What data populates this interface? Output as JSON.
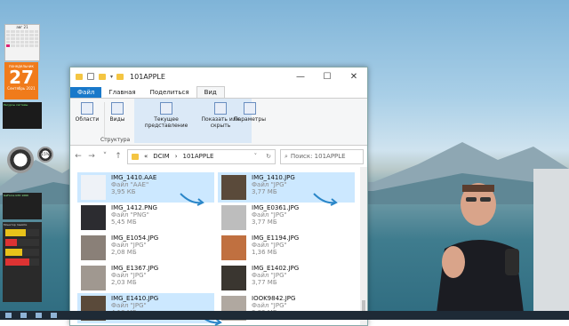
{
  "window": {
    "title": "101APPLE",
    "controls": {
      "minimize": "—",
      "maximize": "☐",
      "close": "✕"
    }
  },
  "ribbon_tabs": [
    "Файл",
    "Главная",
    "Поделиться",
    "Вид"
  ],
  "ribbon": {
    "panels": "Области",
    "views": "Виды",
    "current_view": "Текущее представление",
    "show_hide": "Показать или скрыть",
    "options": "Параметры",
    "group_structure": "Структура"
  },
  "address": {
    "prefix": "«",
    "crumbs": [
      "DCIM",
      "101APPLE"
    ],
    "search_placeholder": "Поиск: 101APPLE"
  },
  "files": [
    {
      "name": "IMG_1410.AAE",
      "type": "Файл \"AAE\"",
      "size": "3,95 КБ",
      "selected": true,
      "thumb": "#eef2f7"
    },
    {
      "name": "IMG_1410.JPG",
      "type": "Файл \"JPG\"",
      "size": "3,77 МБ",
      "selected": true,
      "thumb": "#5a4a3a"
    },
    {
      "name": "IMG_1412.PNG",
      "type": "Файл \"PNG\"",
      "size": "5,45 МБ",
      "selected": false,
      "thumb": "#2c2c30"
    },
    {
      "name": "IMG_E0361.JPG",
      "type": "Файл \"JPG\"",
      "size": "3,77 МБ",
      "selected": false,
      "thumb": "#bdbdbd"
    },
    {
      "name": "IMG_E1054.JPG",
      "type": "Файл \"JPG\"",
      "size": "2,08 МБ",
      "selected": false,
      "thumb": "#8a8078"
    },
    {
      "name": "IMG_E1194.JPG",
      "type": "Файл \"JPG\"",
      "size": "1,36 МБ",
      "selected": false,
      "thumb": "#c07040"
    },
    {
      "name": "IMG_E1367.JPG",
      "type": "Файл \"JPG\"",
      "size": "2,03 МБ",
      "selected": false,
      "thumb": "#a09890"
    },
    {
      "name": "IMG_E1402.JPG",
      "type": "Файл \"JPG\"",
      "size": "3,77 МБ",
      "selected": false,
      "thumb": "#3a3630"
    },
    {
      "name": "IMG_E1410.JPG",
      "type": "Файл \"JPG\"",
      "size": "4,13 МБ",
      "selected": true,
      "thumb": "#5a4a3a"
    },
    {
      "name": "IOOK9842.JPG",
      "type": "Файл \"JPG\"",
      "size": "3,82 МБ",
      "selected": false,
      "thumb": "#b0a8a0"
    }
  ],
  "gadgets": {
    "calendar_header": "авг 21",
    "clock_dow": "понедельник",
    "clock_day": "27",
    "clock_month": "Сентябрь 2021",
    "cpu_label": "Ресурсы системы",
    "gauge_value": "15%",
    "gpu_label": "GeForce GTX 1060",
    "sensor_label": "Монитор памяти"
  },
  "colors": {
    "accent": "#1979ca",
    "selection": "#cce8ff",
    "orange_gadget": "#f07b1b",
    "arrow": "#2a86c8"
  }
}
